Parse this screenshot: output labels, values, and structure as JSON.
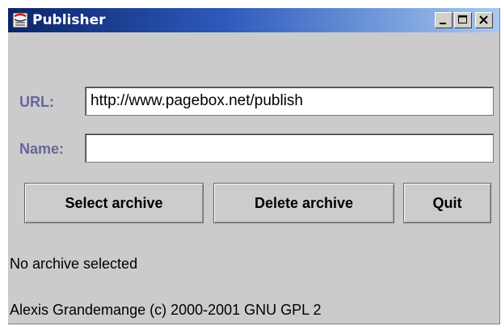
{
  "window": {
    "title": "Publisher",
    "controls": [
      "minimize-icon",
      "maximize-icon",
      "close-icon"
    ]
  },
  "form": {
    "url_label": "URL:",
    "url_value": "http://www.pagebox.net/publish",
    "name_label": "Name:",
    "name_value": ""
  },
  "buttons": {
    "select": "Select archive",
    "delete": "Delete archive",
    "quit": "Quit"
  },
  "status": {
    "message": "No archive selected",
    "copyright": "Alexis Grandemange (c) 2000-2001 GNU GPL 2"
  },
  "colors": {
    "titlebar_start": "#0a246a",
    "titlebar_end": "#a6caf0",
    "label": "#66669a",
    "background": "#cbcbcb"
  }
}
